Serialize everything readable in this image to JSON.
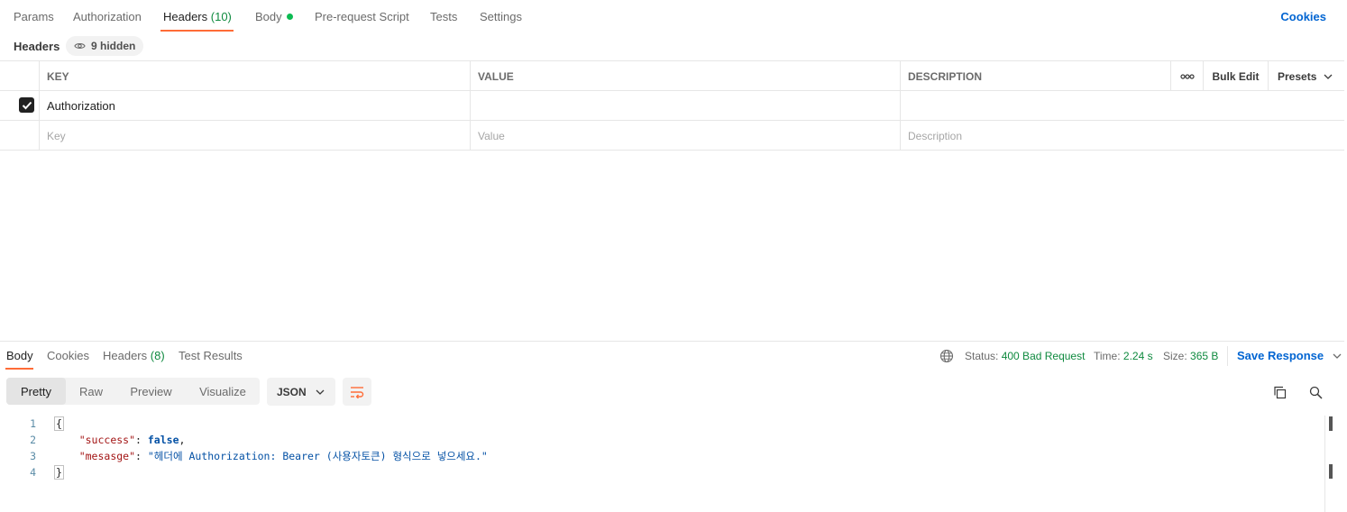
{
  "request_tabs": {
    "params": "Params",
    "authorization": "Authorization",
    "headers": "Headers",
    "headers_count": "(10)",
    "body": "Body",
    "prerequest": "Pre-request Script",
    "tests": "Tests",
    "settings": "Settings",
    "cookies": "Cookies"
  },
  "headers_section": {
    "title": "Headers",
    "hidden": "9 hidden"
  },
  "headers_table": {
    "columns": [
      "KEY",
      "VALUE",
      "DESCRIPTION"
    ],
    "more": "ooo",
    "bulk_edit": "Bulk Edit",
    "presets": "Presets",
    "rows": [
      {
        "checked": true,
        "key": "Authorization",
        "value": "",
        "description": ""
      }
    ],
    "placeholders": {
      "key": "Key",
      "value": "Value",
      "description": "Description"
    }
  },
  "response_tabs": {
    "body": "Body",
    "cookies": "Cookies",
    "headers": "Headers",
    "headers_count": "(8)",
    "test_results": "Test Results"
  },
  "response_meta": {
    "status_label": "Status:",
    "status_value": "400 Bad Request",
    "time_label": "Time:",
    "time_value": "2.24 s",
    "size_label": "Size:",
    "size_value": "365 B",
    "save": "Save Response"
  },
  "view_modes": [
    "Pretty",
    "Raw",
    "Preview",
    "Visualize"
  ],
  "active_view": "Pretty",
  "format": "JSON",
  "code": {
    "line_numbers": [
      "1",
      "2",
      "3",
      "4"
    ],
    "open_brace": "{",
    "close_brace": "}",
    "key1": "\"success\"",
    "val1": "false",
    "key2": "\"mesasge\"",
    "val2": "\"헤더에 Authorization: Bearer (사용자토큰) 형식으로 넣으세요.\""
  },
  "colors": {
    "accent": "#ff6c37",
    "link": "#0265d2",
    "success": "#0f8a3f",
    "body_dot": "#0cbb52"
  }
}
